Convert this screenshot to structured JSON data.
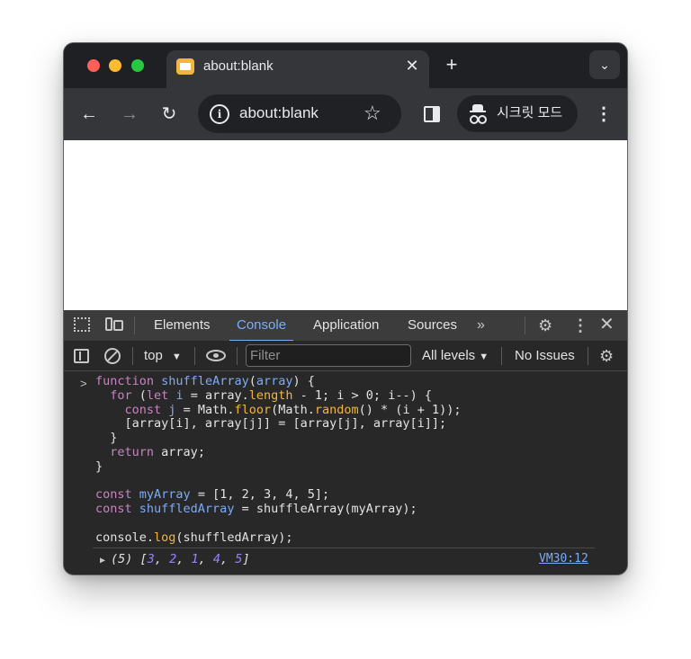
{
  "browser": {
    "tab_title": "about:blank",
    "tab_close": "✕",
    "new_tab": "+",
    "tab_search": "⌄",
    "url": "about:blank",
    "incognito_label": "시크릿 모드",
    "back": "←",
    "forward": "→",
    "reload": "↻",
    "bookmark": "☆",
    "menu": "⋮"
  },
  "devtools": {
    "tabs": [
      "Elements",
      "Console",
      "Application",
      "Sources"
    ],
    "active_tab": "Console",
    "more_tabs": "»",
    "menu": "⋮",
    "close": "✕",
    "settings": "⚙",
    "console_toolbar": {
      "context": "top",
      "filter_placeholder": "Filter",
      "levels": "All levels",
      "issues": "No Issues"
    },
    "input_code": [
      "function shuffleArray(array) {",
      "  for (let i = array.length - 1; i > 0; i--) {",
      "    const j = Math.floor(Math.random() * (i + 1));",
      "    [array[i], array[j]] = [array[j], array[i]];",
      "  }",
      "  return array;",
      "}",
      "",
      "const myArray = [1, 2, 3, 4, 5];",
      "const shuffledArray = shuffleArray(myArray);",
      "",
      "console.log(shuffledArray);"
    ],
    "output": {
      "count": "(5)",
      "values": [
        "3",
        "2",
        "1",
        "4",
        "5"
      ],
      "source": "VM30:12"
    }
  },
  "colors": {
    "accent": "#7cacf8",
    "keyword": "#c586c0",
    "property": "#f2b63c",
    "number": "#9980ff",
    "traffic_red": "#fe5f57",
    "traffic_yellow": "#febc2e",
    "traffic_green": "#28c840"
  },
  "icons": [
    "inspect-icon",
    "device-toolbar-icon",
    "gear-icon",
    "sidebar-icon",
    "clear-console-icon",
    "eye-icon",
    "info-icon",
    "star-icon",
    "incognito-icon",
    "side-panel-icon"
  ]
}
